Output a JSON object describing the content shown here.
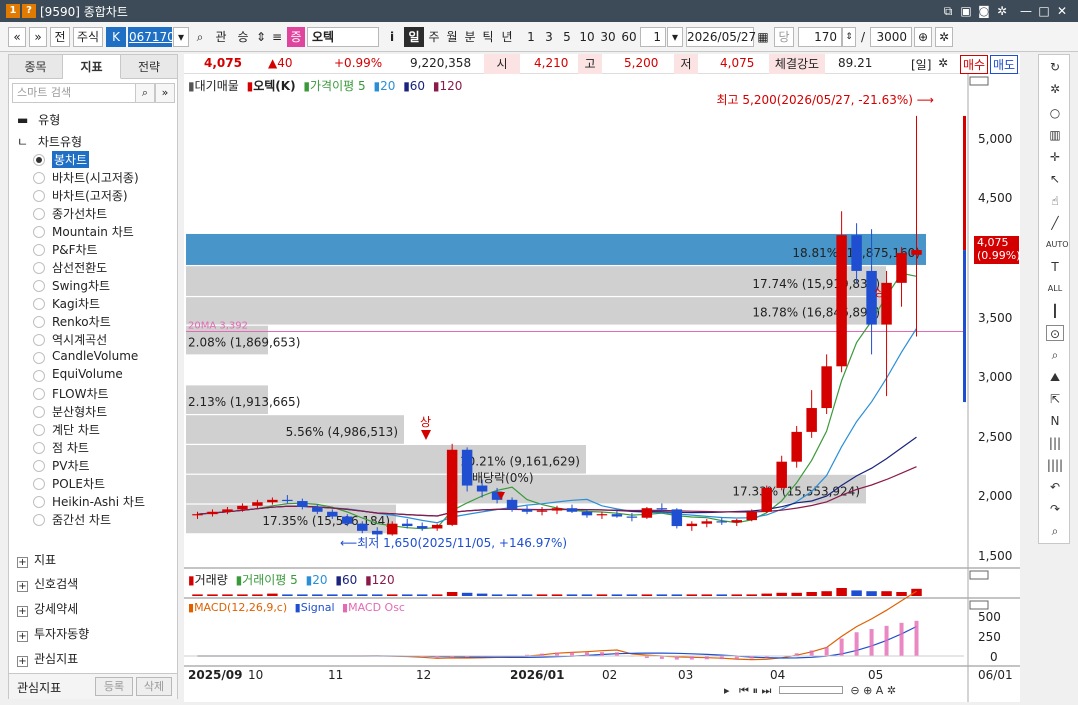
{
  "window": {
    "badges": [
      "1",
      "?"
    ],
    "title": "[9590] 종합차트"
  },
  "toolbar": {
    "nav_prev": "«",
    "nav_down": "»",
    "jeon": "전",
    "market": "주식",
    "k_badge": "K",
    "code": "067170",
    "gwan": "관",
    "seung": "승",
    "jeung": "증",
    "stock_name": "오텍",
    "info": "i",
    "periods": [
      "일",
      "주",
      "월",
      "분",
      "틱",
      "년"
    ],
    "period_selected": "일",
    "intervals": [
      "1",
      "3",
      "5",
      "10",
      "30",
      "60"
    ],
    "interval_value": "1",
    "date": "2026/05/27",
    "dang": "당",
    "count": "170",
    "separator": "/",
    "total": "3000"
  },
  "left_panel": {
    "tabs": [
      "종목",
      "지표",
      "전략"
    ],
    "active_tab": "지표",
    "search_placeholder": "스마트 검색",
    "group_title": "유형",
    "chart_type_header": "차트유형",
    "chart_types": [
      "봉차트",
      "바차트(시고저종)",
      "바차트(고저종)",
      "종가선차트",
      "Mountain 차트",
      "P&F차트",
      "삼선전환도",
      "Swing차트",
      "Kagi차트",
      "Renko차트",
      "역시계곡선",
      "CandleVolume",
      "EquiVolume",
      "FLOW차트",
      "분산형차트",
      "계단 차트",
      "점 차트",
      "PV차트",
      "POLE차트",
      "Heikin-Ashi 차트",
      "줌간선 차트"
    ],
    "selected_type": "봉차트",
    "sections": [
      "지표",
      "신호검색",
      "강세약세",
      "투자자동향",
      "관심지표"
    ],
    "bottom_label": "관심지표",
    "register": "등록",
    "delete": "삭제"
  },
  "quote": {
    "price": "4,075",
    "change": "▲40",
    "change_pct": "+0.99%",
    "volume": "9,220,358",
    "open_label": "시",
    "open": "4,210",
    "high_label": "고",
    "high": "5,200",
    "low_label": "저",
    "low": "4,075",
    "strength_label": "체결강도",
    "strength": "89.21",
    "period_tag": "[일]",
    "buy": "매수",
    "sell": "매도"
  },
  "price_chart": {
    "legend": [
      "대기매물",
      "오텍(K)",
      "가격이평 5",
      "20",
      "60",
      "120"
    ],
    "high_note": "최고 5,200(2026/05/27, -21.63%)",
    "low_note": "최저 1,650(2025/11/05, +146.97%)",
    "dividend_note": "배당락(0%)",
    "sang": "상",
    "current_price": "4,075",
    "current_pct": "(0.99%)",
    "volume_profile": [
      {
        "label": "18.81% (16,875,160)",
        "price_lo": 3950,
        "price_hi": 4210,
        "highlight": true
      },
      {
        "label": "17.74% (15,919,835)",
        "price_lo": 3690,
        "price_hi": 3940,
        "highlight": false
      },
      {
        "label": "18.78% (16,846,893)",
        "price_lo": 3450,
        "price_hi": 3680,
        "highlight": false
      },
      {
        "label": "2.08% (1,869,653)",
        "price_lo": 3200,
        "price_hi": 3440,
        "highlight": false
      },
      {
        "label": "2.13% (1,913,665)",
        "price_lo": 2700,
        "price_hi": 2940,
        "highlight": false
      },
      {
        "label": "5.56% (4,986,513)",
        "price_lo": 2450,
        "price_hi": 2690,
        "highlight": false
      },
      {
        "label": "10.21% (9,161,629)",
        "price_lo": 2200,
        "price_hi": 2440,
        "highlight": false
      },
      {
        "label": "17.33% (15,553,924)",
        "price_lo": 1950,
        "price_hi": 2190,
        "highlight": false
      },
      {
        "label": "17.35% (15,596,184)",
        "price_lo": 1700,
        "price_hi": 1940,
        "highlight": false
      }
    ],
    "pink_line_label": "20MA 3,392",
    "y_ticks": [
      "5,000",
      "4,500",
      "4,000",
      "3,500",
      "3,000",
      "2,500",
      "2,000",
      "1,500"
    ]
  },
  "volume_chart": {
    "legend": [
      "거래량",
      "거래이평 5",
      "20",
      "60",
      "120"
    ]
  },
  "macd_chart": {
    "legend": [
      "MACD(12,26,9,c)",
      "Signal",
      "MACD Osc"
    ],
    "y_ticks": [
      "500",
      "250",
      "0"
    ]
  },
  "x_axis": {
    "labels": [
      "2025/09",
      "10",
      "11",
      "12",
      "2026/01",
      "02",
      "03",
      "04",
      "05"
    ],
    "end_label": "06/01"
  },
  "colors": {
    "up": "#d40000",
    "down": "#1f4fd0",
    "ma5": "#3a9a3a",
    "ma20": "#2a8fd8",
    "ma60": "#1a237e",
    "ma120": "#8b1a4a",
    "band": "#c8c8c8",
    "band_highlight": "#3d8fc6"
  },
  "chart_data": {
    "type": "bar",
    "title": "",
    "xlabel": "",
    "ylabel": "",
    "ylim": [
      1400,
      5300
    ],
    "candles": [
      {
        "o": 1850,
        "h": 1880,
        "l": 1820,
        "c": 1860
      },
      {
        "o": 1860,
        "h": 1900,
        "l": 1840,
        "c": 1880
      },
      {
        "o": 1880,
        "h": 1920,
        "l": 1860,
        "c": 1900
      },
      {
        "o": 1900,
        "h": 1950,
        "l": 1880,
        "c": 1930
      },
      {
        "o": 1930,
        "h": 1980,
        "l": 1910,
        "c": 1960
      },
      {
        "o": 1960,
        "h": 2000,
        "l": 1940,
        "c": 1980
      },
      {
        "o": 1980,
        "h": 2020,
        "l": 1950,
        "c": 1970
      },
      {
        "o": 1970,
        "h": 1990,
        "l": 1900,
        "c": 1920
      },
      {
        "o": 1920,
        "h": 1940,
        "l": 1860,
        "c": 1880
      },
      {
        "o": 1880,
        "h": 1900,
        "l": 1820,
        "c": 1840
      },
      {
        "o": 1840,
        "h": 1860,
        "l": 1760,
        "c": 1780
      },
      {
        "o": 1780,
        "h": 1800,
        "l": 1700,
        "c": 1720
      },
      {
        "o": 1720,
        "h": 1750,
        "l": 1650,
        "c": 1690
      },
      {
        "o": 1690,
        "h": 1800,
        "l": 1680,
        "c": 1780
      },
      {
        "o": 1780,
        "h": 1820,
        "l": 1740,
        "c": 1760
      },
      {
        "o": 1760,
        "h": 1790,
        "l": 1720,
        "c": 1740
      },
      {
        "o": 1740,
        "h": 1780,
        "l": 1720,
        "c": 1770
      },
      {
        "o": 1770,
        "h": 2450,
        "l": 1760,
        "c": 2400
      },
      {
        "o": 2400,
        "h": 2420,
        "l": 2050,
        "c": 2100
      },
      {
        "o": 2100,
        "h": 2150,
        "l": 2000,
        "c": 2050
      },
      {
        "o": 2050,
        "h": 2080,
        "l": 1950,
        "c": 1980
      },
      {
        "o": 1980,
        "h": 2000,
        "l": 1880,
        "c": 1900
      },
      {
        "o": 1900,
        "h": 1930,
        "l": 1860,
        "c": 1880
      },
      {
        "o": 1880,
        "h": 1920,
        "l": 1850,
        "c": 1890
      },
      {
        "o": 1890,
        "h": 1930,
        "l": 1860,
        "c": 1910
      },
      {
        "o": 1910,
        "h": 1940,
        "l": 1870,
        "c": 1880
      },
      {
        "o": 1880,
        "h": 1900,
        "l": 1830,
        "c": 1850
      },
      {
        "o": 1850,
        "h": 1880,
        "l": 1820,
        "c": 1860
      },
      {
        "o": 1860,
        "h": 1890,
        "l": 1830,
        "c": 1840
      },
      {
        "o": 1840,
        "h": 1870,
        "l": 1800,
        "c": 1830
      },
      {
        "o": 1830,
        "h": 1920,
        "l": 1820,
        "c": 1910
      },
      {
        "o": 1910,
        "h": 1950,
        "l": 1880,
        "c": 1900
      },
      {
        "o": 1900,
        "h": 1910,
        "l": 1740,
        "c": 1760
      },
      {
        "o": 1760,
        "h": 1800,
        "l": 1720,
        "c": 1780
      },
      {
        "o": 1780,
        "h": 1820,
        "l": 1750,
        "c": 1800
      },
      {
        "o": 1800,
        "h": 1830,
        "l": 1770,
        "c": 1790
      },
      {
        "o": 1790,
        "h": 1820,
        "l": 1760,
        "c": 1810
      },
      {
        "o": 1810,
        "h": 1900,
        "l": 1800,
        "c": 1880
      },
      {
        "o": 1880,
        "h": 2100,
        "l": 1870,
        "c": 2080
      },
      {
        "o": 2080,
        "h": 2350,
        "l": 2060,
        "c": 2300
      },
      {
        "o": 2300,
        "h": 2600,
        "l": 2250,
        "c": 2550
      },
      {
        "o": 2550,
        "h": 2900,
        "l": 2500,
        "c": 2750
      },
      {
        "o": 2750,
        "h": 3200,
        "l": 2700,
        "c": 3100
      },
      {
        "o": 3100,
        "h": 4400,
        "l": 3050,
        "c": 4200
      },
      {
        "o": 4200,
        "h": 4300,
        "l": 3800,
        "c": 3900
      },
      {
        "o": 3900,
        "h": 4250,
        "l": 3200,
        "c": 3450
      },
      {
        "o": 3450,
        "h": 3900,
        "l": 2850,
        "c": 3800
      },
      {
        "o": 3800,
        "h": 4100,
        "l": 3600,
        "c": 4050
      },
      {
        "o": 4035,
        "h": 5200,
        "l": 3350,
        "c": 4075
      }
    ]
  }
}
